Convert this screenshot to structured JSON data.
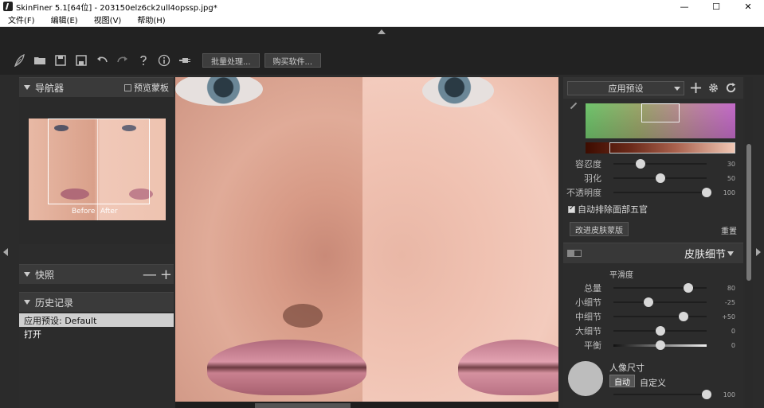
{
  "window": {
    "title": "SkinFiner 5.1[64位] - 203150elz6ck2ull4opssp.jpg*",
    "minimize": "—",
    "maximize": "☐",
    "close": "✕"
  },
  "menu": [
    "文件(F)",
    "编辑(E)",
    "视图(V)",
    "帮助(H)"
  ],
  "toolbar": {
    "batch_label": "批量处理...",
    "buy_label": "购买软件..."
  },
  "navigator": {
    "title": "导航器",
    "preview_mask_label": "预览蒙板",
    "before_label": "Before",
    "after_label": "After"
  },
  "snapshot": {
    "title": "快照",
    "minus": "—",
    "plus": "+"
  },
  "history": {
    "title": "历史记录",
    "items": [
      "应用预设: Default",
      "打开"
    ]
  },
  "right": {
    "preset_label": "应用预设",
    "sliders_top": [
      {
        "label": "容忍度",
        "value": "30",
        "pos": 0.29
      },
      {
        "label": "羽化",
        "value": "50",
        "pos": 0.5
      },
      {
        "label": "不透明度",
        "value": "100",
        "pos": 1.0
      }
    ],
    "auto_exclude_label": "自动排除面部五官",
    "refine_btn": "改进皮肤蒙版",
    "reset_label": "重置",
    "skin_detail_title": "皮肤细节",
    "smoothness_label": "平滑度",
    "sliders_detail": [
      {
        "label": "总量",
        "value": "80",
        "pos": 0.8
      },
      {
        "label": "小细节",
        "value": "-25",
        "pos": 0.375
      },
      {
        "label": "中细节",
        "value": "+50",
        "pos": 0.75
      },
      {
        "label": "大细节",
        "value": "0",
        "pos": 0.5
      },
      {
        "label": "平衡",
        "value": "0",
        "pos": 0.5
      }
    ],
    "portrait_size_label": "人像尺寸",
    "auto_label": "自动",
    "custom_label": "自定义",
    "portrait_slider": {
      "value": "100",
      "pos": 1.0
    }
  }
}
